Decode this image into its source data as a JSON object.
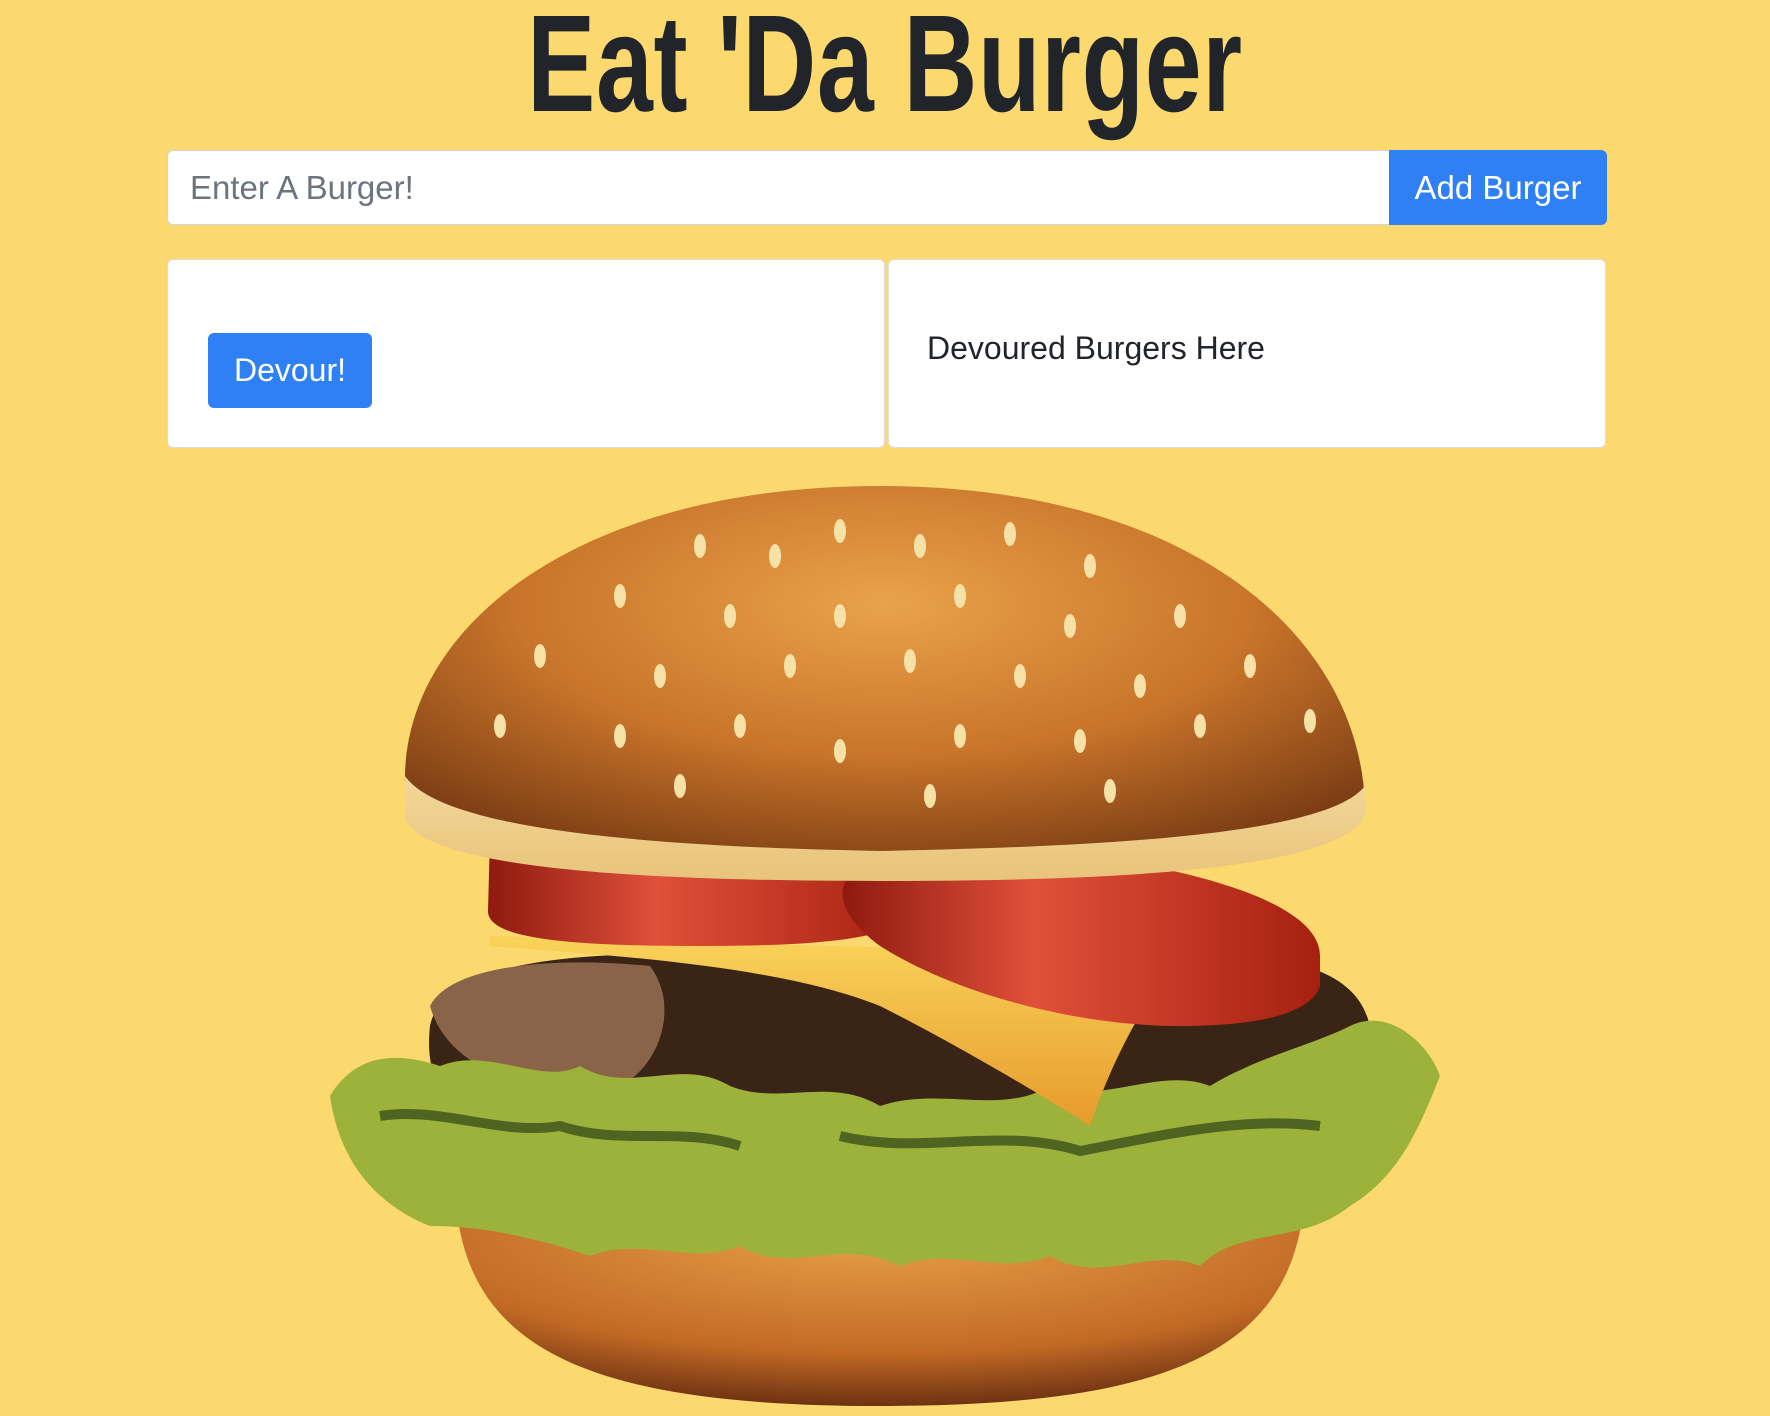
{
  "header": {
    "title": "Eat 'Da Burger"
  },
  "form": {
    "placeholder": "Enter A Burger!",
    "value": "",
    "submit_label": "Add Burger"
  },
  "lists": {
    "uneaten": {
      "devour_label": "Devour!"
    },
    "devoured": {
      "heading": "Devoured Burgers Here"
    }
  },
  "colors": {
    "background": "#fbd96f",
    "primary": "#2f80f5",
    "title": "#212529"
  }
}
